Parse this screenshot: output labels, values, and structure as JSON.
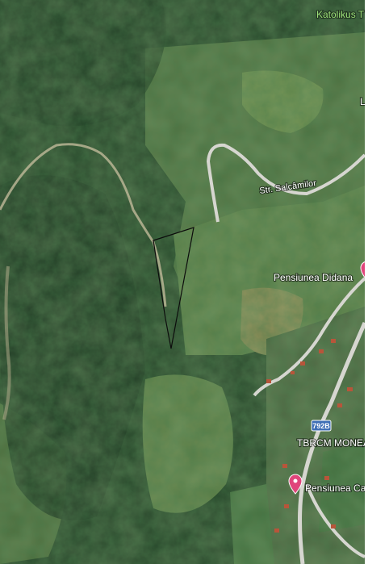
{
  "map": {
    "view": "satellite",
    "labels": {
      "katolikus": "Katolikus T",
      "edge_letter": "L",
      "street": "Str. Salcâmilor",
      "pension_didana": "Pensiunea Didana",
      "road_number": "792B",
      "tbrcm": "TBRCM MONEA",
      "pension_ca": "Pensiunea Ca"
    },
    "colors": {
      "forest_dark": "#1d3a22",
      "forest_mid": "#2e4f2c",
      "meadow": "#5c7d45",
      "field": "#8a8a55",
      "road": "#d8d8d2",
      "road_badge": "#3f6fb6",
      "pin": "#e0457b"
    }
  }
}
